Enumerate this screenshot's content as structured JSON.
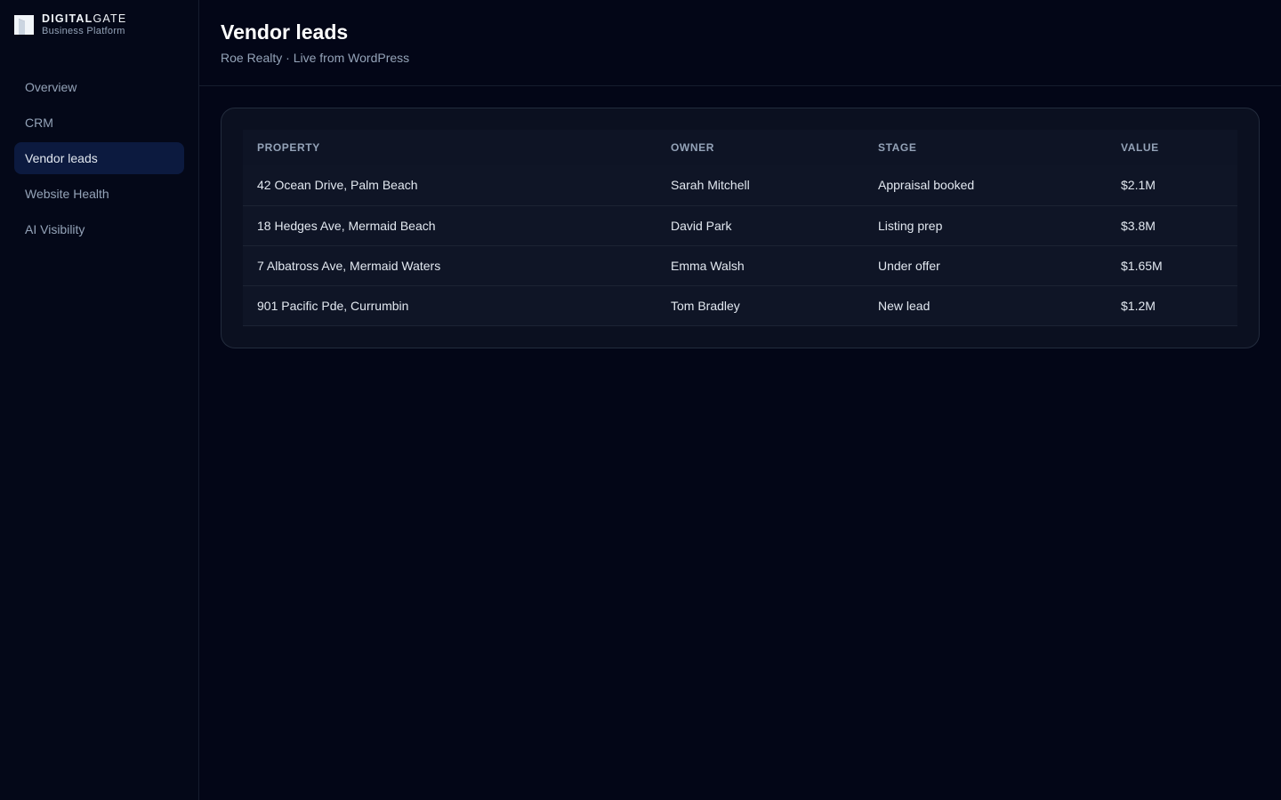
{
  "brand": {
    "name_strong": "DIGITAL",
    "name_light": "GATE",
    "subtitle": "Business Platform",
    "logo_icon": "door-icon"
  },
  "sidebar": {
    "items": [
      {
        "label": "Overview",
        "active": false
      },
      {
        "label": "CRM",
        "active": false
      },
      {
        "label": "Vendor leads",
        "active": true
      },
      {
        "label": "Website Health",
        "active": false
      },
      {
        "label": "AI Visibility",
        "active": false
      }
    ]
  },
  "header": {
    "title": "Vendor leads",
    "subtitle": "Roe Realty · Live from WordPress"
  },
  "table": {
    "columns": [
      "PROPERTY",
      "OWNER",
      "STAGE",
      "VALUE"
    ],
    "rows": [
      {
        "property": "42 Ocean Drive, Palm Beach",
        "owner": "Sarah Mitchell",
        "stage": "Appraisal booked",
        "value": "$2.1M"
      },
      {
        "property": "18 Hedges Ave, Mermaid Beach",
        "owner": "David Park",
        "stage": "Listing prep",
        "value": "$3.8M"
      },
      {
        "property": "7 Albatross Ave, Mermaid Waters",
        "owner": "Emma Walsh",
        "stage": "Under offer",
        "value": "$1.65M"
      },
      {
        "property": "901 Pacific Pde, Currumbin",
        "owner": "Tom Bradley",
        "stage": "New lead",
        "value": "$1.2M"
      }
    ]
  },
  "colors": {
    "background": "#030617",
    "sidebar_active": "#0c1a3f",
    "muted_text": "#94a3b8"
  }
}
